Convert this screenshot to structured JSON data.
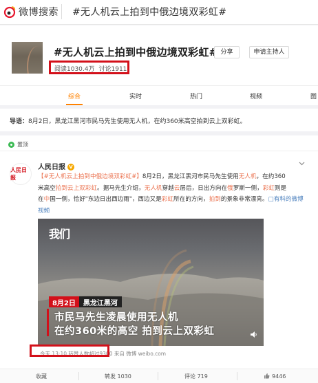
{
  "header": {
    "logo_icon": "weibo-eye-icon",
    "logo_text": "微博搜索",
    "query": "#无人机云上拍到中俄边境双彩虹#"
  },
  "topic": {
    "title": "#无人机云上拍到中俄边境双彩虹#",
    "share_label": "分享",
    "apply_host_label": "申请主持人",
    "reads": "阅读1030.4万",
    "discussions": "讨论1911",
    "tabs": [
      "综合",
      "实时",
      "热门",
      "视频",
      "图"
    ],
    "active_tab": "综合"
  },
  "lead": {
    "label": "导语：",
    "text": "8月2日，黑龙江黑河市民马先生使用无人机，在约360米高空拍到云上双彩虹。"
  },
  "post": {
    "pinned_label": "置顶",
    "avatar_text": "人民日报",
    "author": "人民日报",
    "verified_badge": "V",
    "menu_icon": "chevron-down-icon",
    "text": {
      "hashtag": "【#无人机云上拍到中俄边境双彩虹#】",
      "p1": "8月2日，黑龙江黑河市民马先生使用",
      "k1": "无人机",
      "p2": "，在约360",
      "p3": "米高空",
      "k2": "拍到云上双彩虹",
      "p4": "。据马先生介绍，",
      "k3": "无人机",
      "p5": "穿越",
      "k4": "云",
      "p6": "层后，日出方向在",
      "k5": "俄",
      "p7": "罗斯一侧，",
      "k6": "彩虹",
      "p8": "则是",
      "p9": "在",
      "k7": "中",
      "p10": "国一侧，恰好\"东边日出西边雨\"，西边又是",
      "k8": "彩虹",
      "p11": "所在的方向，",
      "k9": "拍到",
      "p12": "的景象非常漂亮。",
      "video_link": "□有料的微博视频"
    },
    "video": {
      "logo": "我们",
      "date_tag": "8月2日",
      "location_tag": "黑龙江黑河",
      "caption_line1": "市民马先生凌晨使用无人机",
      "caption_line2": "在约360米的高空 拍到云上双彩虹",
      "mute_icon": "speaker-icon"
    },
    "meta": {
      "time": "今天 13:10",
      "forward_count": "转赞人数超过9300",
      "source": "来自 微博 weibo.com"
    },
    "actions": {
      "favorite": "收藏",
      "repost": "转发 1030",
      "comment": "评论 719",
      "like_icon": "thumbs-up-icon",
      "like": "9446"
    }
  }
}
